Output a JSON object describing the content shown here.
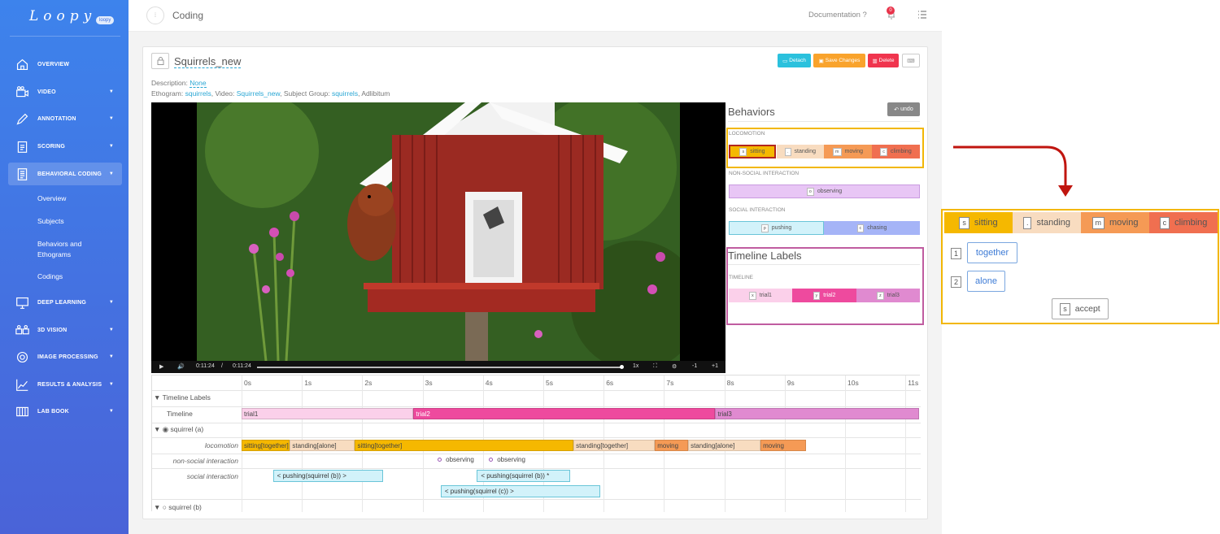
{
  "sidebar": {
    "logo": "Loopy",
    "badge": "loopy",
    "items": [
      {
        "label": "OVERVIEW"
      },
      {
        "label": "VIDEO"
      },
      {
        "label": "ANNOTATION"
      },
      {
        "label": "SCORING"
      },
      {
        "label": "BEHAVIORAL CODING"
      },
      {
        "label": "DEEP LEARNING"
      },
      {
        "label": "3D VISION"
      },
      {
        "label": "IMAGE PROCESSING"
      },
      {
        "label": "RESULTS & ANALYSIS"
      },
      {
        "label": "LAB BOOK"
      }
    ],
    "subitems": [
      "Overview",
      "Subjects",
      "Behaviors and",
      "Ethograms",
      "Codings"
    ]
  },
  "header": {
    "title": "Coding",
    "documentation": "Documentation ?",
    "notifications": "0"
  },
  "coding": {
    "name": "Squirrels_new",
    "detach": "Detach",
    "save": "Save Changes",
    "delete": "Delete",
    "desc_label": "Description:",
    "desc_value": "None",
    "ethogram_label": "Ethogram:",
    "ethogram_value": "squirrels",
    "video_label": ", Video:",
    "video_value": "Squirrels_new",
    "subject_label": ", Subject Group:",
    "subject_value": "squirrels",
    "mode": ", Adlibitum"
  },
  "video": {
    "time_current": "0:11:24",
    "time_sep": "/",
    "time_total": "0:11:24",
    "speed": "1x",
    "minus": "-1",
    "plus": "+1"
  },
  "behaviors": {
    "title": "Behaviors",
    "undo": "undo",
    "locomotion_label": "LOCOMOTION",
    "locomotion": [
      {
        "key": "s",
        "label": "sitting",
        "color": "#f5b800"
      },
      {
        "key": ".",
        "label": "standing",
        "color": "#f8dcc0"
      },
      {
        "key": "m",
        "label": "moving",
        "color": "#f59a55"
      },
      {
        "key": "c",
        "label": "climbing",
        "color": "#f06f50"
      }
    ],
    "nonsocial_label": "NON-SOCIAL INTERACTION",
    "nonsocial": [
      {
        "key": "o",
        "label": "observing",
        "color": "#e8c6f5"
      }
    ],
    "social_label": "SOCIAL INTERACTION",
    "social": [
      {
        "key": "p",
        "label": "pushing",
        "color": "#d2f2fa"
      },
      {
        "key": "c",
        "label": "chasing",
        "color": "#a5b4f7"
      }
    ]
  },
  "timeline_labels": {
    "title": "Timeline Labels",
    "section": "TIMELINE",
    "items": [
      {
        "key": "x",
        "label": "trial1",
        "color": "#fbd0ea"
      },
      {
        "key": "y",
        "label": "trial2",
        "color": "#ee4a9e"
      },
      {
        "key": "z",
        "label": "trial3",
        "color": "#e08ad0"
      }
    ]
  },
  "timeline": {
    "ticks": [
      "0s",
      "1s",
      "2s",
      "3s",
      "4s",
      "5s",
      "6s",
      "7s",
      "8s",
      "9s",
      "10s",
      "11s"
    ],
    "group1": "▼ Timeline Labels",
    "row_timeline": "Timeline",
    "trials": [
      {
        "label": "trial1",
        "start": 0,
        "end": 2.85,
        "color": "#fbd0ea"
      },
      {
        "label": "trial2",
        "start": 2.85,
        "end": 7.85,
        "color": "#ee4a9e"
      },
      {
        "label": "trial3",
        "start": 7.85,
        "end": 11.25,
        "color": "#e08ad0"
      }
    ],
    "subject_a": "▼ ◉ squirrel (a)",
    "row_loco": "locomotion",
    "row_nonsocial": "non-social interaction",
    "row_social": "social interaction",
    "loco": [
      {
        "label": "sitting[together]",
        "start": 0,
        "end": 0.8,
        "color": "#f5b800"
      },
      {
        "label": "standing[alone]",
        "start": 0.8,
        "end": 1.88,
        "color": "#f8dcc0"
      },
      {
        "label": "sitting[together]",
        "start": 1.88,
        "end": 5.5,
        "color": "#f5b800"
      },
      {
        "label": "standing[together]",
        "start": 5.5,
        "end": 6.85,
        "color": "#f8dcc0"
      },
      {
        "label": "moving",
        "start": 6.85,
        "end": 7.4,
        "color": "#f59a55"
      },
      {
        "label": "standing[alone]",
        "start": 7.4,
        "end": 8.6,
        "color": "#f8dcc0"
      },
      {
        "label": "moving",
        "start": 8.6,
        "end": 9.35,
        "color": "#f59a55"
      }
    ],
    "observing": [
      {
        "label": "observing",
        "at": 3.25
      },
      {
        "label": "observing",
        "at": 4.1
      }
    ],
    "social": [
      {
        "label": "< pushing(squirrel (b)) >",
        "start": 0.52,
        "end": 2.35,
        "lane": 0
      },
      {
        "label": "< pushing(squirrel (b)) *",
        "start": 3.9,
        "end": 5.45,
        "lane": 0
      },
      {
        "label": "< pushing(squirrel (c)) >",
        "start": 3.3,
        "end": 5.95,
        "lane": 1
      }
    ],
    "subject_b": "▼ ○ squirrel (b)"
  },
  "zoom": {
    "chips": [
      {
        "key": "s",
        "label": "sitting",
        "color": "#f5b800"
      },
      {
        "key": ".",
        "label": "standing",
        "color": "#f8dcc0"
      },
      {
        "key": "m",
        "label": "moving",
        "color": "#f59a55"
      },
      {
        "key": "c",
        "label": "climbing",
        "color": "#f06f50"
      }
    ],
    "opt1_num": "1",
    "opt1": "together",
    "opt2_num": "2",
    "opt2": "alone",
    "accept_key": "s",
    "accept": "accept"
  }
}
